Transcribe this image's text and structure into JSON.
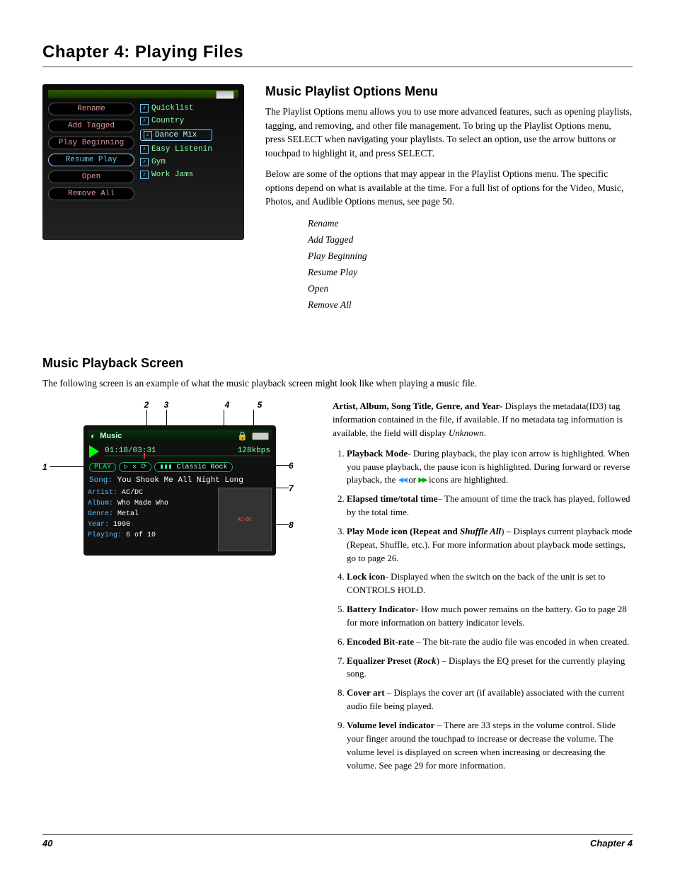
{
  "chapter_title": "Chapter 4: Playing Files",
  "section1": {
    "title": "Music Playlist Options Menu",
    "para1": "The Playlist Options menu allows you to use more advanced features, such as opening playlists, tagging, and removing, and other file management. To bring up the Playlist Options menu, press SELECT when navigating your playlists. To select an option, use the arrow buttons or touchpad to highlight it, and press SELECT.",
    "para2": "Below are some of the options that may appear in the Playlist Options menu.  The specific options depend on what is available at the time. For a full list of options for the Video, Music, Photos, and Audible Options menus, see page 50.",
    "options": [
      "Rename",
      "Add Tagged",
      "Play Beginning",
      "Resume Play",
      "Open",
      "Remove All"
    ]
  },
  "screenshot1": {
    "menu": [
      "Rename",
      "Add Tagged",
      "Play Beginning",
      "Resume Play",
      "Open",
      "Remove All"
    ],
    "selected_menu": "Resume Play",
    "playlists": [
      "Quicklist",
      "Country",
      "Dance Mix",
      "Easy Listenin",
      "Gym",
      "Work Jams"
    ],
    "selected_playlist": "Dance Mix"
  },
  "section2": {
    "title": "Music Playback Screen",
    "intro": "The following screen is an example of what the music playback screen might look like when playing a music file."
  },
  "player": {
    "title": "Music",
    "time": "01:18/03:31",
    "bitrate": "128kbps",
    "play_label": "PLAY",
    "eq_preset": "Classic Rock",
    "song_label": "Song:",
    "song": "You Shook Me All Night Long",
    "artist_label": "Artist:",
    "artist": "AC/DC",
    "album_label": "Album:",
    "album": "Who Made Who",
    "genre_label": "Genre:",
    "genre": "Metal",
    "year_label": "Year:",
    "year": "1990",
    "playing_label": "Playing:",
    "playing": "6 of 10",
    "cover_text": "AC⚡DC"
  },
  "callouts_top": [
    "2",
    "3",
    "4",
    "5"
  ],
  "callouts_side": {
    "c1": "1",
    "c6": "6",
    "c7": "7",
    "c8": "8"
  },
  "defs": {
    "lead_bold": "Artist, Album, Song Title, Genre, and Year-",
    "lead_rest": " Displays the metadata(ID3) tag information contained in the file, if available. If no metadata tag information is available, the field will display ",
    "lead_unknown": "Unknown",
    "items": [
      {
        "t": "Playback Mode",
        "rest": "-  During playback, the play icon arrow is highlighted. When you pause playback, the pause icon is highlighted. During forward or reverse playback, the ",
        "tail": " icons are highlighted."
      },
      {
        "t": "Elapsed time/total time",
        "rest": "– The amount of time the track has played, followed by the total time."
      },
      {
        "t": "Play Mode icon (Repeat and ",
        "em": "Shuffle All",
        "rest2": ") – Displays current playback mode (Repeat, Shuffle, etc.). For more information about playback mode settings, go to page 26."
      },
      {
        "t": "Lock icon",
        "rest": "- Displayed when the switch on the back of the unit is set to CONTROLS HOLD."
      },
      {
        "t": "Battery Indicator",
        "rest": "- How much power remains on the battery. Go to page 28 for more information on battery indicator levels."
      },
      {
        "t": "Encoded Bit-rate",
        "rest": " –  The bit-rate the audio file was encoded in when created."
      },
      {
        "t": "Equalizer Preset (",
        "em": "Rock",
        "rest2": ") –  Displays the EQ preset for the currently playing song."
      },
      {
        "t": "Cover art",
        "rest": " – Displays the cover art (if available) associated with the current audio file being played."
      },
      {
        "t": "Volume level indicator",
        "rest": "  –  There are 33 steps in the volume control. Slide your finger around the touchpad to increase or decrease the volume. The volume level is displayed on screen when increasing or decreasing the volume. See page 29 for more information."
      }
    ]
  },
  "footer": {
    "page": "40",
    "chapter": "Chapter  4"
  }
}
